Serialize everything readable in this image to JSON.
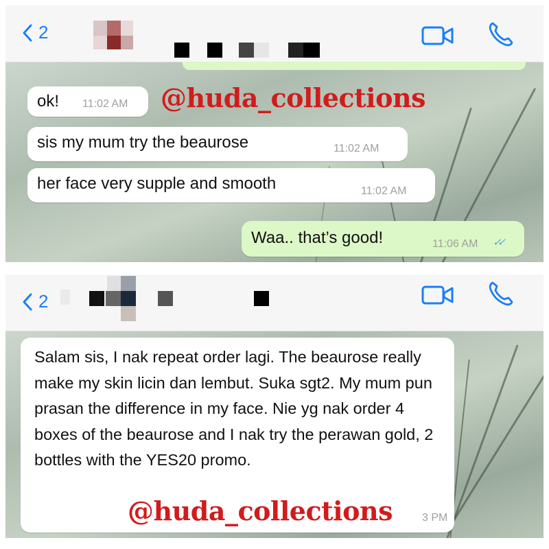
{
  "panel1": {
    "back_count": "2",
    "messages": [
      {
        "text": "ok!",
        "time": "11:02 AM"
      },
      {
        "text": "sis my mum try the beaurose",
        "time": "11:02 AM"
      },
      {
        "text": "her face very supple and smooth",
        "time": "11:02 AM"
      }
    ],
    "sent": {
      "text": "Waa.. that’s good!",
      "time": "11:06 AM",
      "ticks": "✓✓"
    },
    "watermark": "@huda_collections"
  },
  "panel2": {
    "back_count": "2",
    "message": {
      "text": "Salam sis, I nak repeat order lagi. The beaurose really make my skin licin dan lembut. Suka sgt2. My mum pun prasan the difference in my face. Nie yg nak order 4 boxes of the beaurose and I nak try the perawan gold, 2 bottles with the YES20 promo.",
      "time": "3 PM"
    },
    "watermark": "@huda_collections"
  },
  "colors": {
    "accent": "#1a7efb",
    "incoming_bubble": "#ffffff",
    "outgoing_bubble": "#dcf8c6",
    "watermark": "#d11c1c",
    "tick": "#4fa3e0"
  },
  "icons": [
    "chevron-left-icon",
    "video-call-icon",
    "phone-icon",
    "double-check-icon"
  ]
}
